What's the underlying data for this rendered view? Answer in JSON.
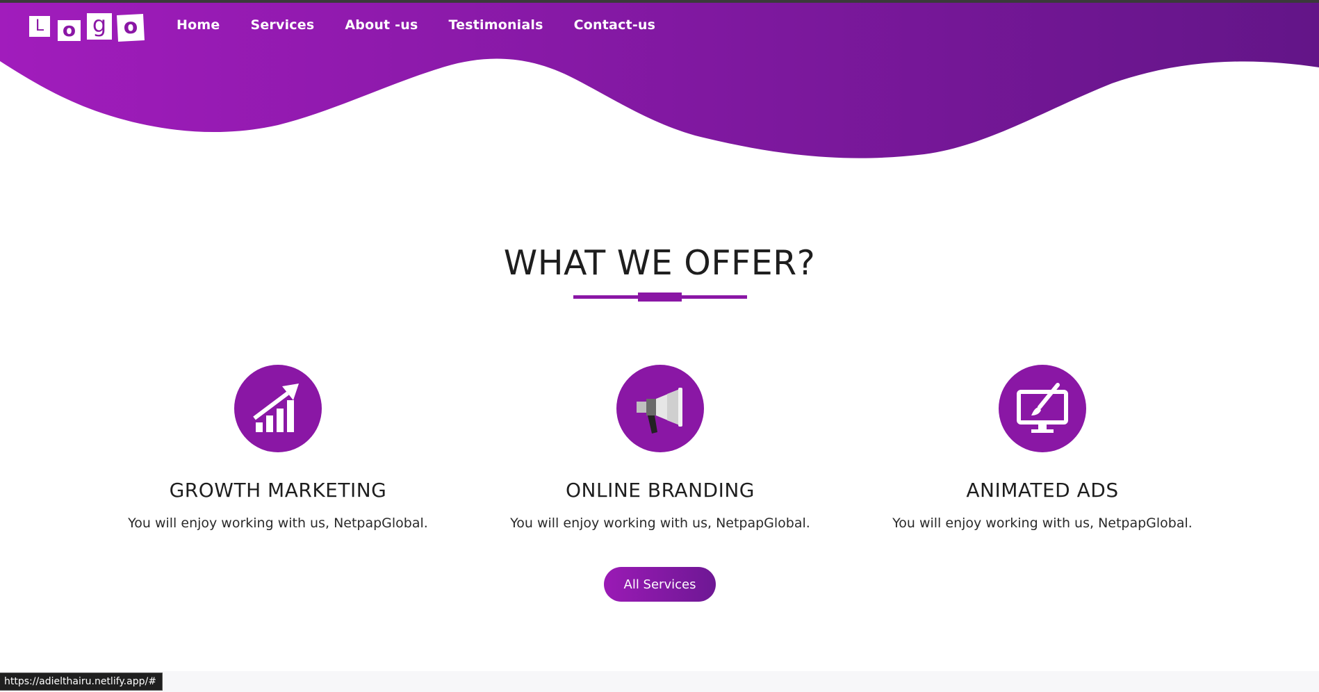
{
  "colors": {
    "brand_purple": "#8a17a5",
    "gradient_start": "#a11cbc",
    "gradient_end": "#631588",
    "heading_text": "#1e1e1e"
  },
  "header": {
    "logo_letters": [
      "L",
      "o",
      "g",
      "o"
    ],
    "nav": [
      {
        "label": "Home"
      },
      {
        "label": "Services"
      },
      {
        "label": "About -us"
      },
      {
        "label": "Testimonials"
      },
      {
        "label": "Contact-us"
      }
    ]
  },
  "offer_section": {
    "title": "WHAT WE OFFER?",
    "services": [
      {
        "icon": "growth-chart-icon",
        "title": "GROWTH MARKETING",
        "description": "You will enjoy working with us, NetpapGlobal."
      },
      {
        "icon": "megaphone-icon",
        "title": "ONLINE BRANDING",
        "description": "You will enjoy working with us, NetpapGlobal."
      },
      {
        "icon": "monitor-brush-icon",
        "title": "ANIMATED ADS",
        "description": "You will enjoy working with us, NetpapGlobal."
      }
    ],
    "cta_label": "All Services"
  },
  "status_bar": {
    "url": "https://adielthairu.netlify.app/#"
  }
}
